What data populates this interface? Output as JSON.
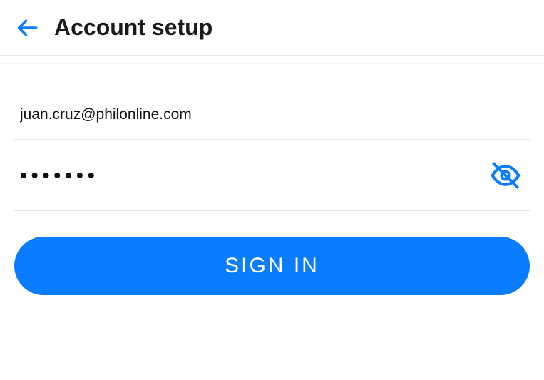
{
  "header": {
    "title": "Account setup"
  },
  "form": {
    "email_value": "juan.cruz@philonline.com",
    "password_masked": "•••••••",
    "sign_in_label": "SIGN IN"
  },
  "colors": {
    "accent": "#0a7dff"
  }
}
